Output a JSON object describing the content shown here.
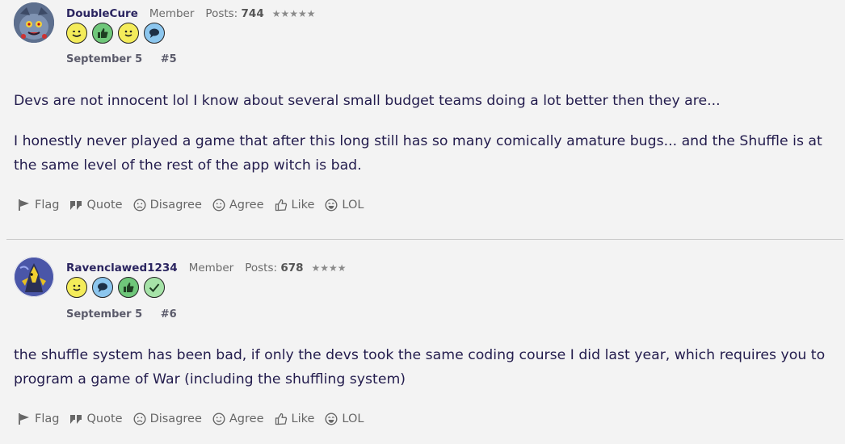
{
  "posts": [
    {
      "username": "DoubleCure",
      "role": "Member",
      "posts_label": "Posts:",
      "posts_count": "744",
      "stars": "★★★★★",
      "date": "September 5",
      "post_number": "#5",
      "paragraphs": [
        "Devs are not innocent lol I know about several small budget teams doing a lot better then they are...",
        "I honestly never played a game that after this long still has so many comically amature bugs... and the Shuffle is at the same level of the rest of the app witch is bad."
      ],
      "badges": [
        "wink-face-icon",
        "thumbs-up-icon",
        "smile-face-icon",
        "speech-bubble-icon"
      ]
    },
    {
      "username": "Ravenclawed1234",
      "role": "Member",
      "posts_label": "Posts:",
      "posts_count": "678",
      "stars": "★★★★",
      "date": "September 5",
      "post_number": "#6",
      "paragraphs": [
        "the shuffle system has been bad, if only the devs took the same coding course I did last year, which requires you to program a game of War (including the shuffling system)"
      ],
      "badges": [
        "smile-face-icon",
        "speech-bubble-icon",
        "thumbs-up-icon",
        "checkmark-icon"
      ]
    }
  ],
  "actions": {
    "flag": "Flag",
    "quote": "Quote",
    "disagree": "Disagree",
    "agree": "Agree",
    "like": "Like",
    "lol": "LOL"
  },
  "colors": {
    "background": "#f3f3f3",
    "text": "#231c4d",
    "badge_yellow": "#f4ec5a",
    "badge_green": "#6fc77a",
    "badge_blue": "#8cc6ee",
    "badge_light_green": "#a6e3a8"
  }
}
